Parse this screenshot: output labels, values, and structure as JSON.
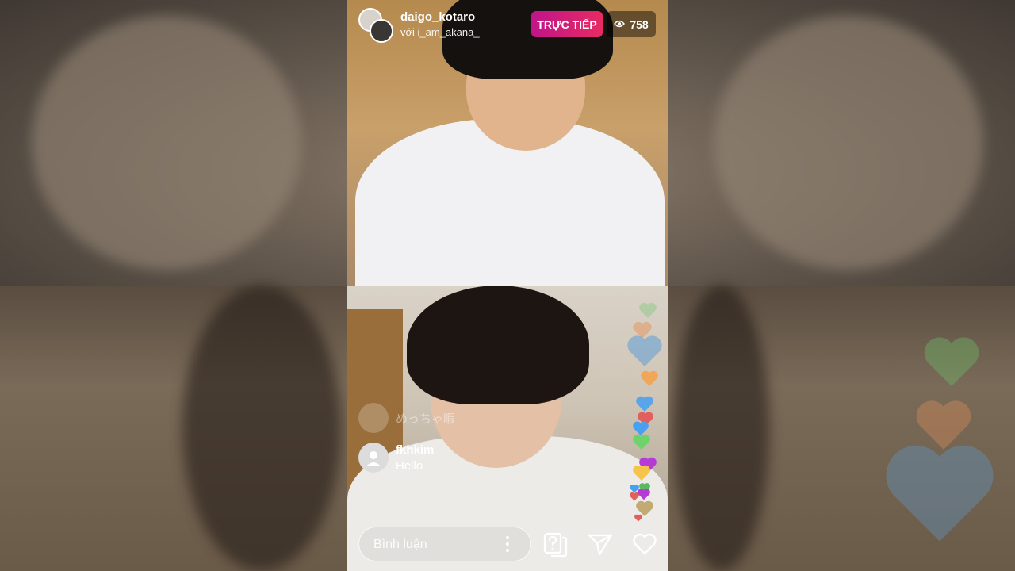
{
  "stream": {
    "host_username": "daigo_kotaro",
    "guest_line": "với i_am_akana_",
    "live_label": "TRỰC TIẾP",
    "viewer_count": "758"
  },
  "comments": [
    {
      "username": "",
      "text": "めっちゃ暇",
      "faded": true
    },
    {
      "username": "fkhkim",
      "text": "Hello",
      "faded": false
    }
  ],
  "composer": {
    "placeholder": "Bình luận"
  },
  "icons": [
    "eye-icon",
    "options-icon",
    "question-icon",
    "send-icon",
    "heart-icon"
  ],
  "colors": {
    "live_start": "#c0158a",
    "live_end": "#e82a63"
  }
}
